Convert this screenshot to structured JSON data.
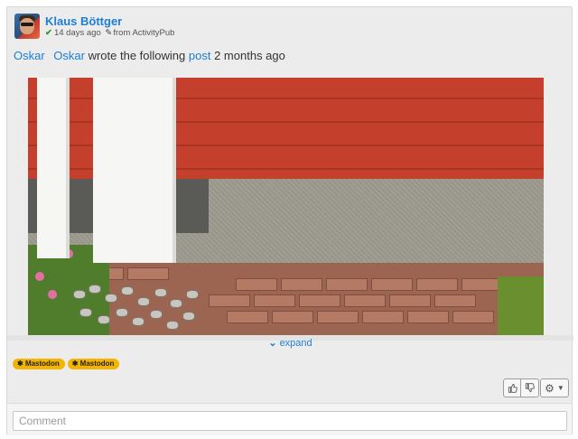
{
  "post": {
    "author": "Klaus Böttger",
    "meta": {
      "verified_icon": "check-icon",
      "time_ago": "14 days ago",
      "edit_icon": "pencil-icon",
      "via": "from ActivityPub"
    },
    "share": {
      "sharer": "Oskar",
      "original_author": "Oskar",
      "text_before": "wrote the following",
      "post_link": "post",
      "text_after": "2 months ago"
    },
    "expand_label": "expand",
    "tags": [
      "Mastodon",
      "Mastodon"
    ],
    "actions": {
      "like_icon": "thumbs-up-icon",
      "dislike_icon": "thumbs-down-icon",
      "settings_icon": "gear-icon"
    },
    "comment_placeholder": "Comment"
  },
  "colors": {
    "link": "#1d7ed6",
    "tag_bg": "#f4b400",
    "card_bg": "#ececec"
  }
}
